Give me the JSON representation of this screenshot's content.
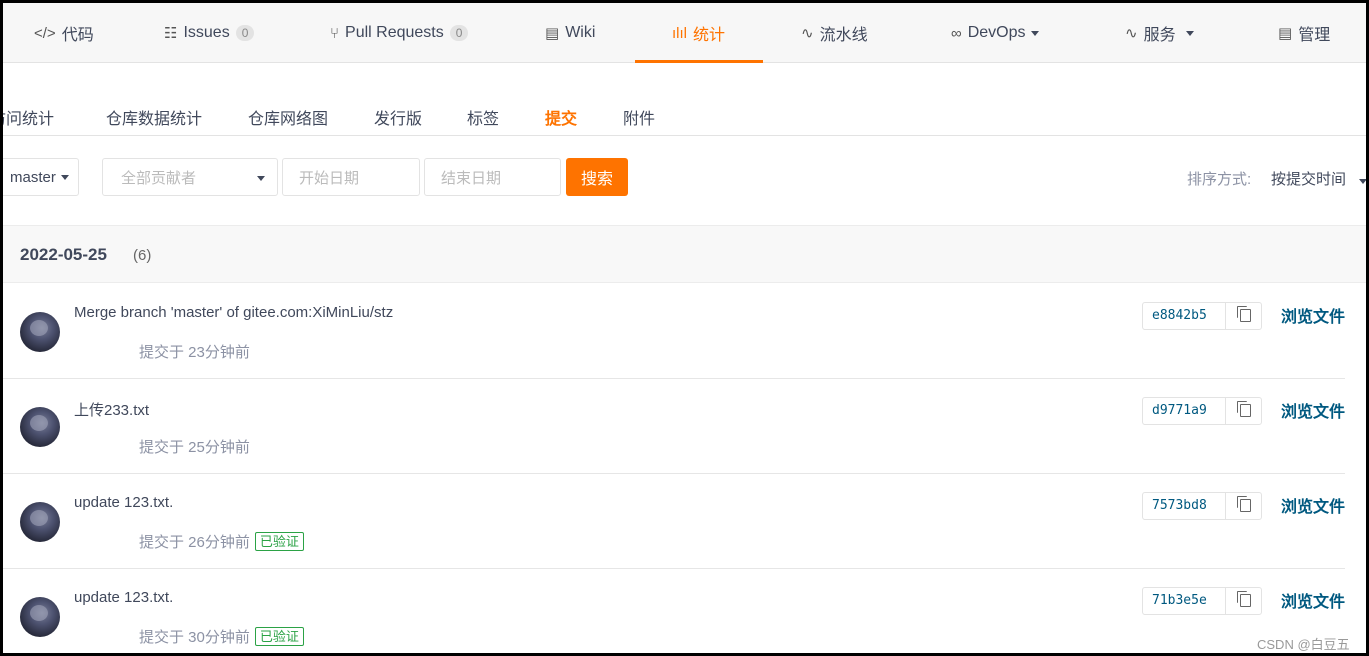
{
  "top_tabs": [
    {
      "icon": "</>",
      "label": "代码"
    },
    {
      "icon": "☷",
      "label": "Issues",
      "count": "0"
    },
    {
      "icon": "⑂",
      "label": "Pull Requests",
      "count": "0"
    },
    {
      "icon": "▤",
      "label": "Wiki"
    },
    {
      "icon": "ılıl",
      "label": "统计"
    },
    {
      "icon": "∿",
      "label": "流水线"
    },
    {
      "icon": "∞",
      "label": "DevOps"
    },
    {
      "icon": "∿",
      "label": "服务"
    },
    {
      "icon": "▤",
      "label": "管理"
    }
  ],
  "sub_tabs": [
    "访问统计",
    "仓库数据统计",
    "仓库网络图",
    "发行版",
    "标签",
    "提交",
    "附件"
  ],
  "filters": {
    "branch": "master",
    "author_placeholder": "全部贡献者",
    "start_placeholder": "开始日期",
    "end_placeholder": "结束日期",
    "search_label": "搜索",
    "sort_label": "排序方式:",
    "sort_value": "按提交时间"
  },
  "date_group": {
    "date": "2022-05-25",
    "count": "(6)"
  },
  "commits": [
    {
      "message": "Merge branch 'master' of gitee.com:XiMinLiu/stz",
      "meta": "提交于 23分钟前",
      "sha": "e8842b5",
      "verified": "",
      "browse": "浏览文件"
    },
    {
      "message": "上传233.txt",
      "meta": "提交于 25分钟前",
      "sha": "d9771a9",
      "verified": "",
      "browse": "浏览文件"
    },
    {
      "message": "update 123.txt.",
      "meta": "提交于 26分钟前",
      "sha": "7573bd8",
      "verified": "已验证",
      "browse": "浏览文件"
    },
    {
      "message": "update 123.txt.",
      "meta": "提交于 30分钟前",
      "sha": "71b3e5e",
      "verified": "已验证",
      "browse": "浏览文件"
    }
  ],
  "watermark": "CSDN @白豆五",
  "colors": {
    "accent": "#fe7300",
    "link": "#005980",
    "verified": "#2ba245"
  }
}
